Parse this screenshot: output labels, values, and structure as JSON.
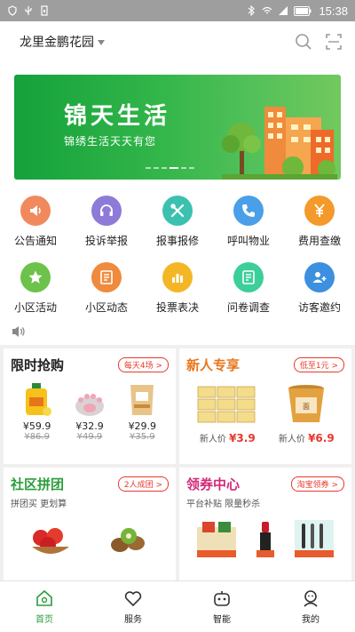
{
  "status": {
    "time": "15:38"
  },
  "header": {
    "location": "龙里金鹏花园"
  },
  "banner": {
    "title": "锦天生活",
    "subtitle": "锦绣生活天天有您"
  },
  "grid": [
    {
      "label": "公告通知",
      "icon": "megaphone-icon",
      "color": "#f08a5d"
    },
    {
      "label": "投诉举报",
      "icon": "headset-icon",
      "color": "#8e7ad8"
    },
    {
      "label": "报事报修",
      "icon": "tools-icon",
      "color": "#3cc1b0"
    },
    {
      "label": "呼叫物业",
      "icon": "phone-icon",
      "color": "#4a9fe8"
    },
    {
      "label": "费用查缴",
      "icon": "yen-icon",
      "color": "#f39a2b"
    },
    {
      "label": "小区活动",
      "icon": "star-icon",
      "color": "#6cc24a"
    },
    {
      "label": "小区动态",
      "icon": "news-icon",
      "color": "#f08a3c"
    },
    {
      "label": "投票表决",
      "icon": "bar-chart-icon",
      "color": "#f5b625"
    },
    {
      "label": "问卷调查",
      "icon": "survey-icon",
      "color": "#3ccf9a"
    },
    {
      "label": "访客邀约",
      "icon": "visitor-icon",
      "color": "#3d8fe0"
    }
  ],
  "cards": {
    "flash": {
      "title": "限时抢购",
      "pill": "每天4场 >",
      "items": [
        {
          "price": "¥59.9",
          "old": "¥86.9"
        },
        {
          "price": "¥32.9",
          "old": "¥49.9"
        },
        {
          "price": "¥29.9",
          "old": "¥35.9"
        }
      ]
    },
    "newuser": {
      "title": "新人专享",
      "pill": "低至1元 >",
      "items": [
        {
          "label": "新人价",
          "price": "¥3.9"
        },
        {
          "label": "新人价",
          "price": "¥6.9"
        }
      ]
    },
    "group": {
      "title": "社区拼团",
      "pill": "2人成团 >",
      "subtitle": "拼团买 更划算"
    },
    "coupon": {
      "title": "领券中心",
      "pill": "淘宝领券 >",
      "subtitle": "平台补贴 限量秒杀"
    }
  },
  "tabs": [
    {
      "label": "首页",
      "icon": "home-icon"
    },
    {
      "label": "服务",
      "icon": "heart-icon"
    },
    {
      "label": "智能",
      "icon": "robot-icon"
    },
    {
      "label": "我的",
      "icon": "user-icon"
    }
  ],
  "colors": {
    "brand_green": "#2a9d3b",
    "accent_red": "#e8382c"
  }
}
